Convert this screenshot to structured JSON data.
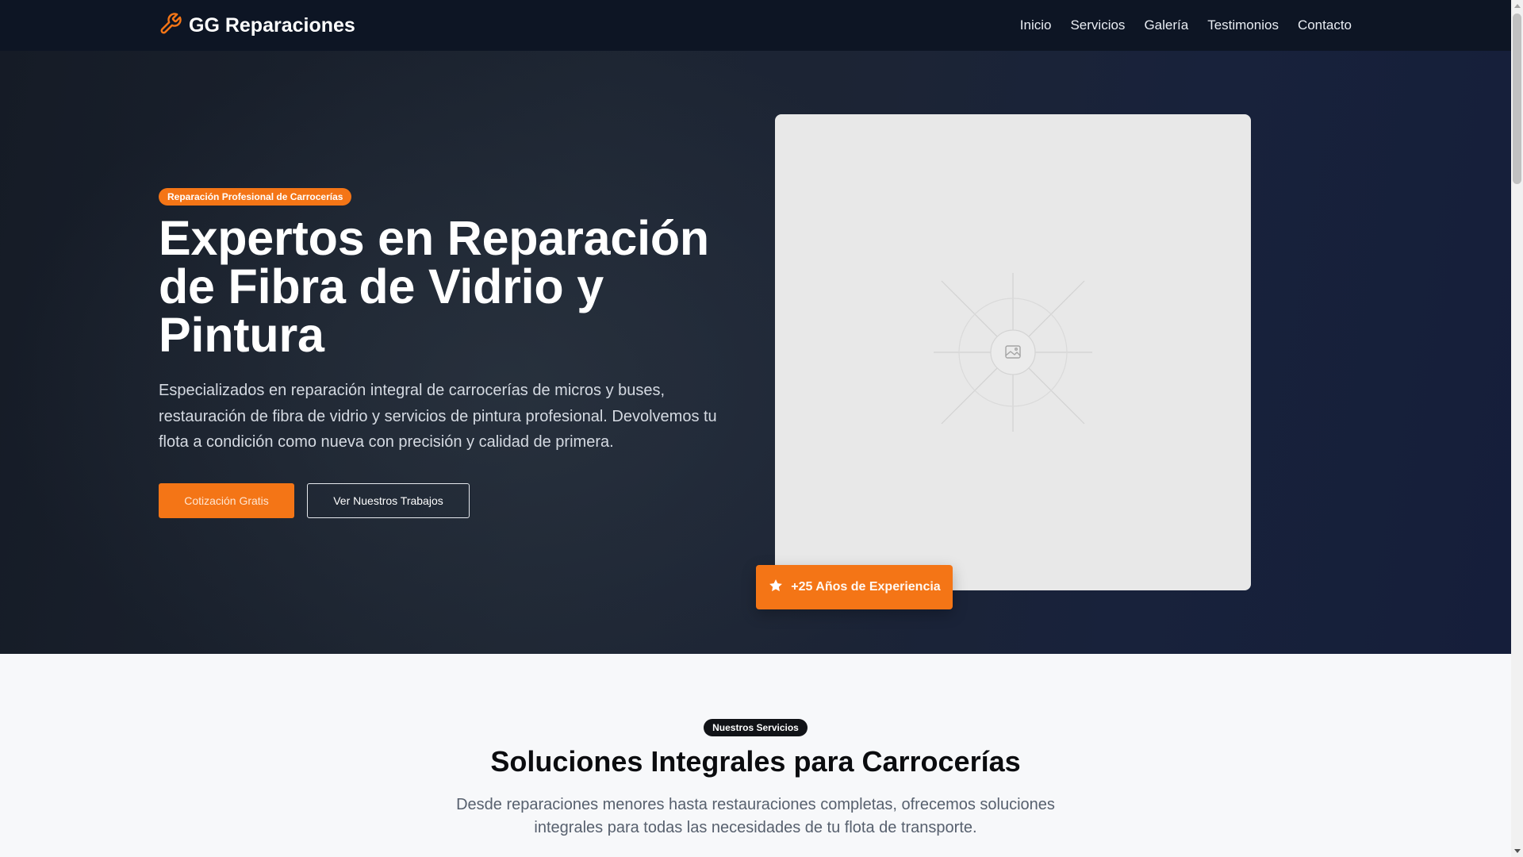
{
  "nav": {
    "brand": "GG Reparaciones",
    "links": [
      "Inicio",
      "Servicios",
      "Galería",
      "Testimonios",
      "Contacto"
    ]
  },
  "hero": {
    "badge": "Reparación Profesional de Carrocerías",
    "title": "Expertos en Reparación de Fibra de Vidrio y Pintura",
    "description": "Especializados en reparación integral de carrocerías de micros y buses, restauración de fibra de vidrio y servicios de pintura profesional. Devolvemos tu flota a condición como nueva con precisión y calidad de primera.",
    "primary_button": "Cotización Gratis",
    "secondary_button": "Ver Nuestros Trabajos",
    "experience_badge": "+25 Años de Experiencia"
  },
  "services": {
    "badge": "Nuestros Servicios",
    "title": "Soluciones Integrales para Carrocerías",
    "description": "Desde reparaciones menores hasta restauraciones completas, ofrecemos soluciones integrales para todas las necesidades de tu flota de transporte."
  },
  "colors": {
    "accent": "#f47516",
    "nav_bg": "#0d1524",
    "hero_bg": "#1c2435",
    "section_bg": "#f7f8fa"
  },
  "icons": {
    "brand": "wrench-icon",
    "experience": "star-icon",
    "image_placeholder": "image-icon"
  }
}
